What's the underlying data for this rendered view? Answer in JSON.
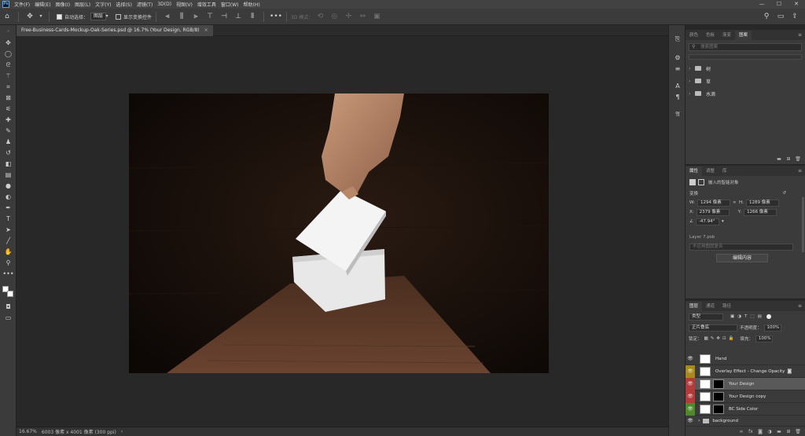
{
  "app": {
    "logo": "Ps"
  },
  "menu": [
    "文件(F)",
    "编辑(E)",
    "图像(I)",
    "图层(L)",
    "文字(Y)",
    "选择(S)",
    "滤镜(T)",
    "3D(D)",
    "视图(V)",
    "增效工具",
    "窗口(W)",
    "帮助(H)"
  ],
  "window_controls": {
    "minimize": "—",
    "maximize": "☐",
    "close": "✕"
  },
  "options": {
    "auto_select_label": "自动选择：",
    "auto_select_value": "图层",
    "show_transform_label": "显示变换控件",
    "mode_3d_label": "3D 模式："
  },
  "document_tab": {
    "title": "Free-Business-Cards-Mockup-Oak-Series.psd @ 16.7% (Your Design, RGB/8)",
    "close": "×"
  },
  "status": {
    "zoom": "16.67%",
    "info": "6003 像素 x 4001 像素 (300 ppi)",
    "arrow": "›"
  },
  "swatches_panel": {
    "tabs": [
      "颜色",
      "色板",
      "渐变",
      "图案"
    ],
    "active_tab": "图案",
    "search_placeholder": "搜索图案",
    "groups": [
      "树",
      "草",
      "水滴"
    ]
  },
  "properties_panel": {
    "tabs": [
      "属性",
      "调整",
      "库"
    ],
    "active_tab": "属性",
    "type_label": "嵌入的智能对象",
    "transform_label": "变换",
    "w_label": "W:",
    "w_value": "1294 像素",
    "h_label": "H:",
    "h_value": "1289 像素",
    "x_label": "X:",
    "x_value": "2379 像素",
    "y_label": "Y:",
    "y_value": "1266 像素",
    "angle_value": "-47.94°",
    "file_label": "Layer 7.psb",
    "comp_placeholder": "不应用图层复合",
    "edit_button": "编辑内容"
  },
  "layers_panel": {
    "tabs": [
      "图层",
      "通道",
      "路径"
    ],
    "active_tab": "图层",
    "filter_value": "类型",
    "blend_mode": "正片叠底",
    "opacity_label": "不透明度：",
    "opacity_value": "100%",
    "lock_label": "锁定：",
    "fill_label": "填充：",
    "fill_value": "100%",
    "layers": [
      {
        "name": "Hand",
        "eye_color": "#3b3b3b",
        "selected": false
      },
      {
        "name": "Overlay Effect - Change Opacity",
        "eye_color": "#a8891a",
        "selected": false
      },
      {
        "name": "Your Design",
        "eye_color": "#b33a3a",
        "selected": true
      },
      {
        "name": "Your Design copy",
        "eye_color": "#b33a3a",
        "selected": false
      },
      {
        "name": "BC Side Color",
        "eye_color": "#4f8a2a",
        "selected": false
      },
      {
        "name": "background",
        "eye_color": "#3b3b3b",
        "selected": false
      }
    ]
  }
}
